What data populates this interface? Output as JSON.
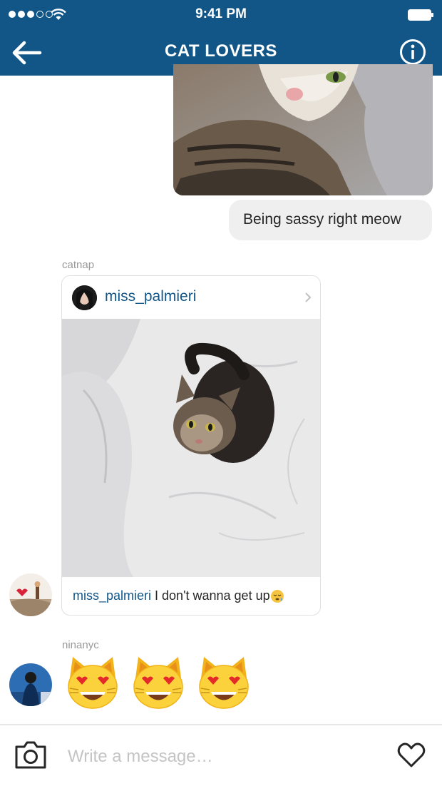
{
  "status_bar": {
    "time": "9:41 PM"
  },
  "header": {
    "title": "CAT LOVERS",
    "back_icon": "back-arrow-icon",
    "info_icon": "info-icon"
  },
  "messages": {
    "outgoing_text": "Being sassy right meow",
    "post_share": {
      "sender": "catnap",
      "post_author": "miss_palmieri",
      "caption_user": "miss_palmieri",
      "caption_text": " I don't wanna get up"
    },
    "emoji_message": {
      "sender": "ninanyc",
      "emoji": [
        "heart-eyes-cat",
        "heart-eyes-cat",
        "heart-eyes-cat"
      ]
    }
  },
  "composer": {
    "placeholder": "Write a message…",
    "camera_icon": "camera-icon",
    "like_icon": "heart-icon"
  },
  "colors": {
    "header_bg": "#125688",
    "username_blue": "#125688",
    "bubble_bg": "#efefef"
  }
}
